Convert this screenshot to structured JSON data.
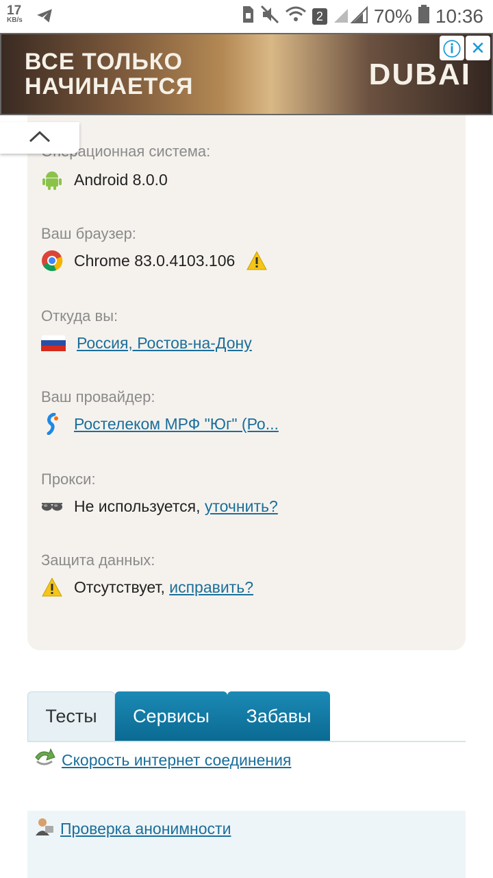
{
  "status_bar": {
    "speed_value": "17",
    "speed_unit": "KB/s",
    "sim_badge": "2",
    "battery": "70%",
    "time": "10:36",
    "icons": [
      "telegram-icon",
      "sim-icon",
      "mute-icon",
      "wifi-icon",
      "signal-icon",
      "battery-icon"
    ]
  },
  "ad": {
    "headline_line1": "ВСЕ ТОЛЬКО",
    "headline_line2": "НАЧИНАЕТСЯ",
    "brand": "DUBAI",
    "info_icon": "ⓘ",
    "close_icon": "✕"
  },
  "collapse": {
    "icon": "chevron-up-icon"
  },
  "info": {
    "os_label": "Операционная система:",
    "os_value": "Android 8.0.0",
    "browser_label": "Ваш браузер:",
    "browser_value": "Chrome 83.0.4103.106",
    "location_label": "Откуда вы:",
    "location_value": "Россия, Ростов-на-Дону",
    "provider_label": "Ваш провайдер:",
    "provider_value": "Ростелеком МРФ \"Юг\" (Ро...",
    "proxy_label": "Прокси:",
    "proxy_value": "Не используется,",
    "proxy_link": "уточнить?",
    "protection_label": "Защита данных:",
    "protection_value": "Отсутствует,",
    "protection_link": "исправить?"
  },
  "tabs": [
    {
      "label": "Тесты"
    },
    {
      "label": "Сервисы"
    },
    {
      "label": "Забавы"
    }
  ],
  "links": {
    "speed_test": "Скорость интернет соединения",
    "anonymity": "Проверка анонимности"
  },
  "colors": {
    "link": "#1a6e9a",
    "tab_active_bg": "#0b6a93",
    "card_bg": "#f5f2ee"
  }
}
